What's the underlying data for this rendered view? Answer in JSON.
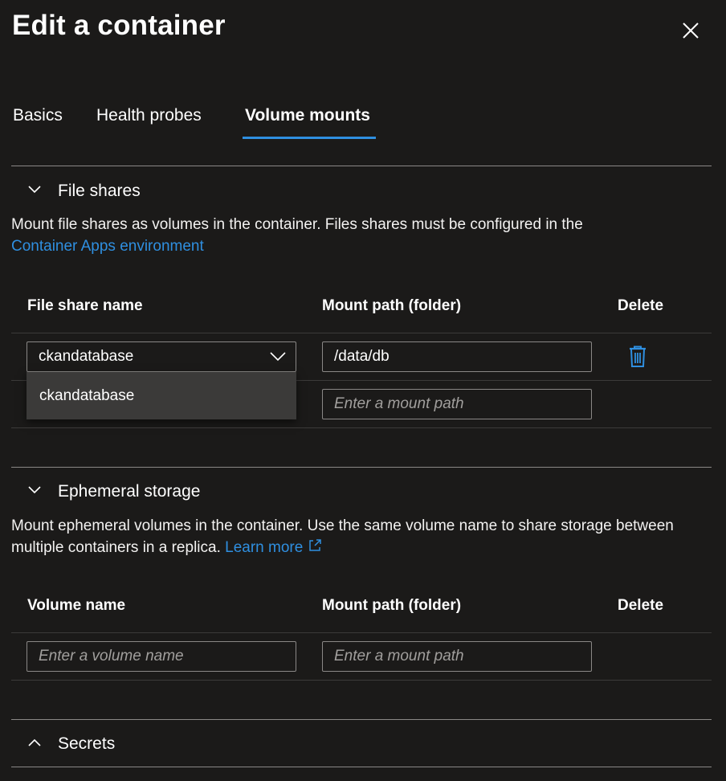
{
  "panel": {
    "title": "Edit a container"
  },
  "tabs": [
    {
      "label": "Basics",
      "active": false
    },
    {
      "label": "Health probes",
      "active": false
    },
    {
      "label": "Volume mounts",
      "active": true
    }
  ],
  "file_shares": {
    "header": "File shares",
    "description": "Mount file shares as volumes in the container. Files shares must be configured in the",
    "link": "Container Apps environment",
    "columns": [
      "File share name",
      "Mount path (folder)",
      "Delete"
    ],
    "rows": [
      {
        "file_share": "ckandatabase",
        "mount_path": "/data/db"
      }
    ],
    "new_row": {
      "mount_path_placeholder": "Enter a mount path"
    },
    "dropdown_options": [
      "ckandatabase"
    ]
  },
  "ephemeral_storage": {
    "header": "Ephemeral storage",
    "description": "Mount ephemeral volumes in the container. Use the same volume name to share storage between multiple containers in a replica.",
    "link": "Learn more",
    "columns": [
      "Volume name",
      "Mount path (folder)",
      "Delete"
    ],
    "new_row": {
      "volume_name_placeholder": "Enter a volume name",
      "mount_path_placeholder": "Enter a mount path"
    }
  },
  "secrets": {
    "header": "Secrets"
  },
  "colors": {
    "background": "#1b1a19",
    "accent": "#2f8fe0",
    "field_border": "#8a8886",
    "flyout": "#3b3a39"
  },
  "icons": [
    "close-icon",
    "chevron-down-icon",
    "chevron-up-icon",
    "delete-icon",
    "external-link-icon"
  ]
}
